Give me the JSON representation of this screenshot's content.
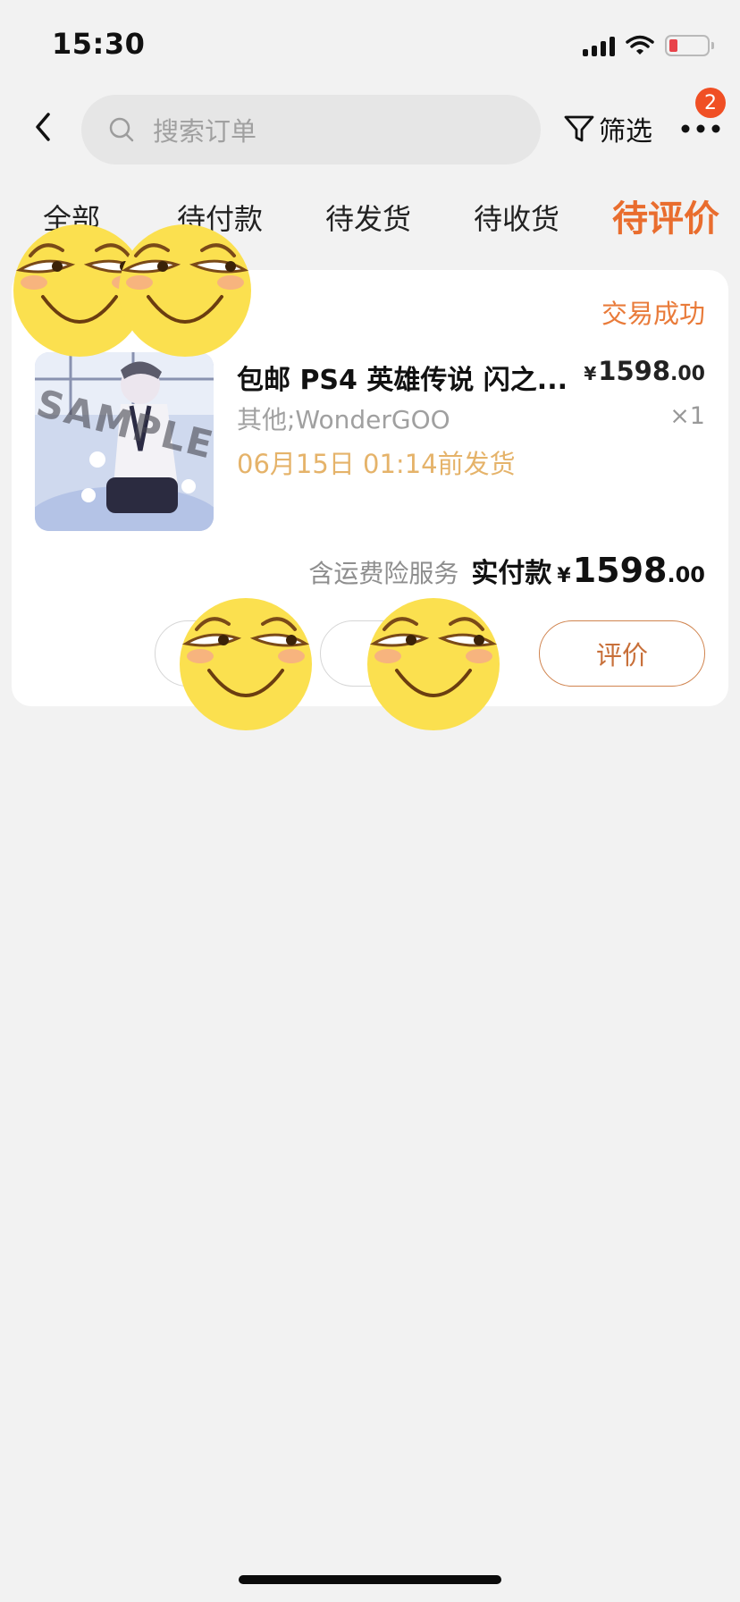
{
  "status_bar": {
    "time": "15:30",
    "icons": [
      "signal-icon",
      "wifi-icon",
      "battery-low-icon"
    ],
    "battery_color": "#e8434a"
  },
  "nav": {
    "search_placeholder": "搜索订单",
    "filter_label": "筛选",
    "more_badge": "2",
    "icons": [
      "back-chevron-icon",
      "search-icon",
      "filter-funnel-icon",
      "more-dots-icon"
    ]
  },
  "tabs": [
    {
      "label": "全部",
      "active": false
    },
    {
      "label": "待付款",
      "active": false
    },
    {
      "label": "待发货",
      "active": false
    },
    {
      "label": "待收货",
      "active": false
    },
    {
      "label": "待评价",
      "active": true
    }
  ],
  "order": {
    "status": "交易成功",
    "thumbnail_watermark": "SAMPLE",
    "product_title": "包邮 PS4 英雄传说 闪之...",
    "unit_price": {
      "currency": "¥",
      "integer": "1598",
      "decimal": ".00"
    },
    "spec": "其他;WonderGOO",
    "quantity": "×1",
    "ship_time": "06月15日 01:14前发货",
    "insurance_text": "含运费险服务",
    "paid_label": "实付款",
    "paid_amount": {
      "currency": "¥",
      "integer": "1598",
      "decimal": ".00"
    },
    "review_button": "评价"
  },
  "colors": {
    "accent": "#e96d2e",
    "badge": "#f04f24",
    "ship_time": "#e5b36a",
    "background": "#f2f2f2"
  },
  "overlay_stickers": [
    "emoji-sticker",
    "emoji-sticker",
    "emoji-sticker",
    "emoji-sticker"
  ]
}
